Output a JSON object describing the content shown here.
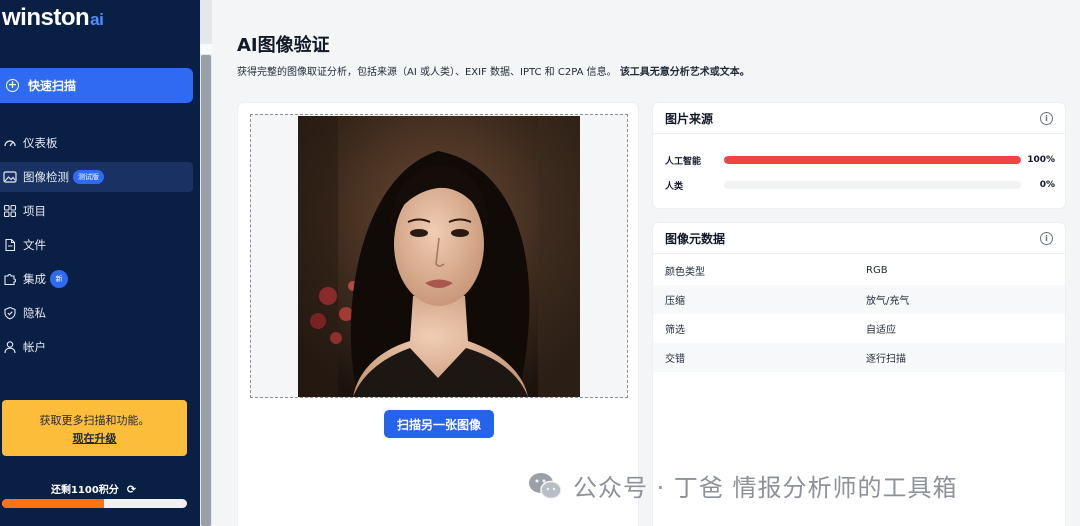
{
  "sidebar": {
    "logo": "winston",
    "logo_suffix": "ai",
    "quick_scan": "快速扫描",
    "items": [
      {
        "label": "仪表板",
        "icon": "dashboard-icon"
      },
      {
        "label": "图像检测",
        "icon": "image-icon",
        "badge": "测试版",
        "active": true
      },
      {
        "label": "项目",
        "icon": "grid-icon"
      },
      {
        "label": "文件",
        "icon": "file-icon"
      },
      {
        "label": "集成",
        "icon": "puzzle-icon",
        "badge": "新"
      },
      {
        "label": "隐私",
        "icon": "shield-icon"
      },
      {
        "label": "帐户",
        "icon": "user-icon"
      }
    ],
    "upgrade_text": "获取更多扫描和功能。",
    "upgrade_link": "现在升级",
    "credits_label": "还剩1100积分",
    "credits_fraction": 0.55
  },
  "main": {
    "title": "AI图像验证",
    "description": "获得完整的图像取证分析，包括来源（AI 或人类）、EXIF 数据、IPTC 和 C2PA 信息。",
    "description_bold": "该工具无意分析艺术或文本。",
    "scan_button": "扫描另一张图像"
  },
  "source_card": {
    "title": "图片来源",
    "rows": [
      {
        "label": "人工智能",
        "percent_text": "100%",
        "value": 1.0
      },
      {
        "label": "人类",
        "percent_text": "0%",
        "value": 0.0
      }
    ]
  },
  "metadata_card": {
    "title": "图像元数据",
    "rows": [
      {
        "key": "颜色类型",
        "value": "RGB"
      },
      {
        "key": "压缩",
        "value": "放气/充气"
      },
      {
        "key": "筛选",
        "value": "自适应"
      },
      {
        "key": "交错",
        "value": "逐行扫描"
      }
    ]
  },
  "watermark": "公众号 · 丁爸 情报分析师的工具箱",
  "colors": {
    "sidebar_bg": "#0a1f44",
    "accent": "#2f6bf2",
    "ai_bar": "#ef4444",
    "upgrade_bg": "#fbbd3a",
    "credit_fill": "#f97316"
  }
}
